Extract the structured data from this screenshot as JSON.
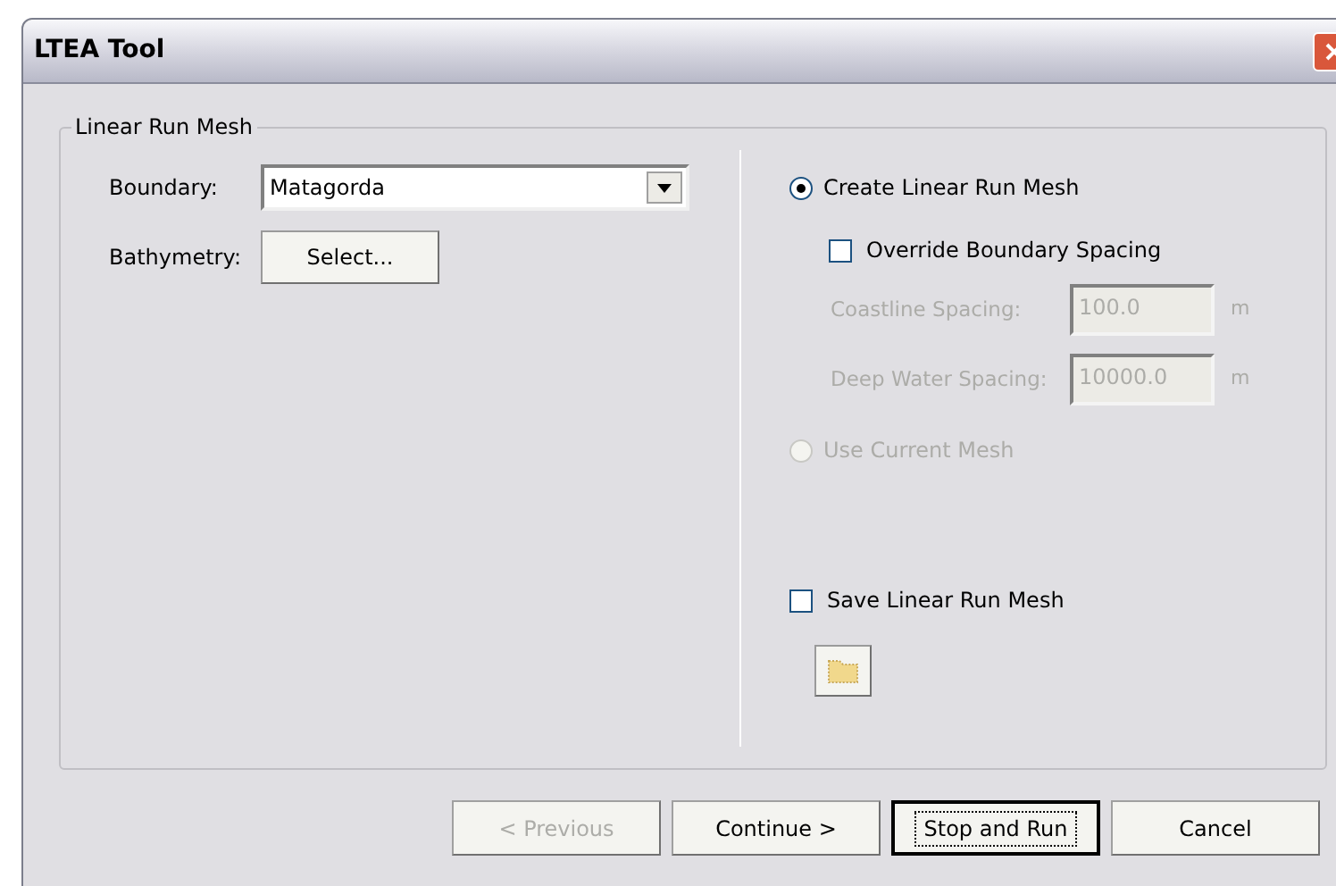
{
  "window": {
    "title": "LTEA Tool"
  },
  "group": {
    "title": "Linear Run Mesh"
  },
  "boundary": {
    "label": "Boundary:",
    "value": "Matagorda"
  },
  "bathymetry": {
    "label": "Bathymetry:",
    "button": "Select..."
  },
  "create_mesh": {
    "label": "Create Linear Run Mesh",
    "selected": true,
    "disabled": false
  },
  "override_spacing": {
    "label": "Override Boundary Spacing",
    "checked": false
  },
  "spacing_fields": [
    {
      "label": "Coastline Spacing:",
      "value": "100.0",
      "unit": "m",
      "disabled": true
    },
    {
      "label": "Deep Water Spacing:",
      "value": "10000.0",
      "unit": "m",
      "disabled": true
    }
  ],
  "use_current_mesh": {
    "label": "Use Current Mesh",
    "selected": false,
    "disabled": true
  },
  "save_mesh": {
    "label": "Save Linear Run Mesh",
    "checked": false
  },
  "buttons": [
    {
      "label": "< Previous",
      "disabled": true,
      "focused": false
    },
    {
      "label": "Continue >",
      "disabled": false,
      "focused": false
    },
    {
      "label": "Stop and Run",
      "disabled": false,
      "focused": true
    },
    {
      "label": "Cancel",
      "disabled": false,
      "focused": false
    }
  ]
}
